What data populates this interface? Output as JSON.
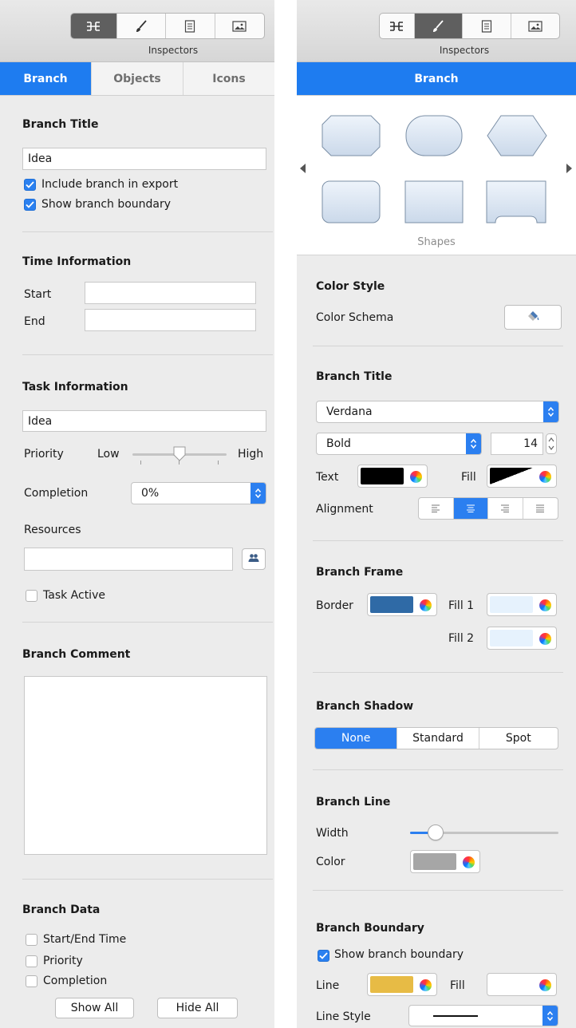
{
  "left": {
    "toolbar_label": "Inspectors",
    "toolbar_icons": [
      "branch-inspector-icon",
      "style-brush-icon",
      "document-icon",
      "image-icon"
    ],
    "tabs": [
      {
        "label": "Branch",
        "active": true
      },
      {
        "label": "Objects",
        "active": false
      },
      {
        "label": "Icons",
        "active": false
      }
    ],
    "branch_title": {
      "heading": "Branch Title",
      "value": "Idea",
      "include_export": "Include branch in export",
      "show_boundary": "Show branch boundary"
    },
    "time_info": {
      "heading": "Time Information",
      "start_label": "Start",
      "start_value": "",
      "end_label": "End",
      "end_value": ""
    },
    "task_info": {
      "heading": "Task Information",
      "value": "Idea",
      "priority_label": "Priority",
      "priority_low": "Low",
      "priority_high": "High",
      "priority_level": 0.5,
      "completion_label": "Completion",
      "completion_value": "0%",
      "resources_label": "Resources",
      "resources_value": "",
      "task_active": "Task Active"
    },
    "comment": {
      "heading": "Branch Comment",
      "value": ""
    },
    "branch_data": {
      "heading": "Branch Data",
      "items": [
        "Start/End Time",
        "Priority",
        "Completion"
      ],
      "show_all": "Show All",
      "hide_all": "Hide All"
    }
  },
  "right": {
    "toolbar_label": "Inspectors",
    "tab_label": "Branch",
    "shapes_label": "Shapes",
    "color_style": {
      "heading": "Color Style",
      "schema_label": "Color Schema"
    },
    "branch_title": {
      "heading": "Branch Title",
      "font": "Verdana",
      "weight": "Bold",
      "size": "14",
      "text_label": "Text",
      "fill_label": "Fill",
      "alignment_label": "Alignment",
      "text_color": "#000000"
    },
    "branch_frame": {
      "heading": "Branch Frame",
      "border_label": "Border",
      "fill1_label": "Fill 1",
      "fill2_label": "Fill 2",
      "border_color": "#2f6aa6",
      "fill1_color": "#e6f2fd",
      "fill2_color": "#e6f2fd"
    },
    "branch_shadow": {
      "heading": "Branch Shadow",
      "options": [
        "None",
        "Standard",
        "Spot"
      ],
      "selected": "None"
    },
    "branch_line": {
      "heading": "Branch Line",
      "width_label": "Width",
      "color_label": "Color",
      "width_level": 0.17,
      "line_color": "#a6a6a6"
    },
    "branch_boundary": {
      "heading": "Branch Boundary",
      "show_boundary": "Show branch boundary",
      "line_label": "Line",
      "fill_label": "Fill",
      "line_style_label": "Line Style",
      "line_color": "#e7bb45",
      "fill_color": "#ffffff"
    }
  },
  "colors": {
    "accent": "#1e7cf0",
    "panel": "#ececec"
  }
}
